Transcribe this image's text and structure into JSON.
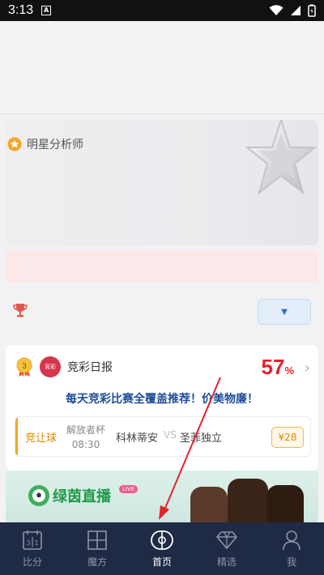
{
  "status_bar": {
    "time": "3:13",
    "notification_letter": "A"
  },
  "star_card": {
    "label": "明星分析师"
  },
  "report": {
    "rank": "3",
    "avatar_text": "竞彩",
    "title": "竞彩日报",
    "rate_value": "57",
    "rate_unit": "%",
    "description": "每天竞彩比赛全覆盖推荐！价美物廉！",
    "match": {
      "type": "竞让球",
      "cup": "解放者杯",
      "time": "08:30",
      "home": "科林蒂安",
      "vs": "VS",
      "away": "圣菲独立",
      "price": "¥28"
    }
  },
  "banner": {
    "title": "绿茵直播",
    "badge": "LIVE"
  },
  "nav": [
    {
      "label": "比分",
      "icon": "calendar-icon",
      "active": false
    },
    {
      "label": "魔方",
      "icon": "cube-grid-icon",
      "active": false
    },
    {
      "label": "首页",
      "icon": "football-field-icon",
      "active": true
    },
    {
      "label": "精选",
      "icon": "diamond-icon",
      "active": false
    },
    {
      "label": "我",
      "icon": "user-icon",
      "active": false
    }
  ],
  "colors": {
    "accent_red": "#e3212b",
    "nav_bg": "#1f2a44",
    "link_blue": "#1f4e9a",
    "orange": "#e08a00"
  }
}
